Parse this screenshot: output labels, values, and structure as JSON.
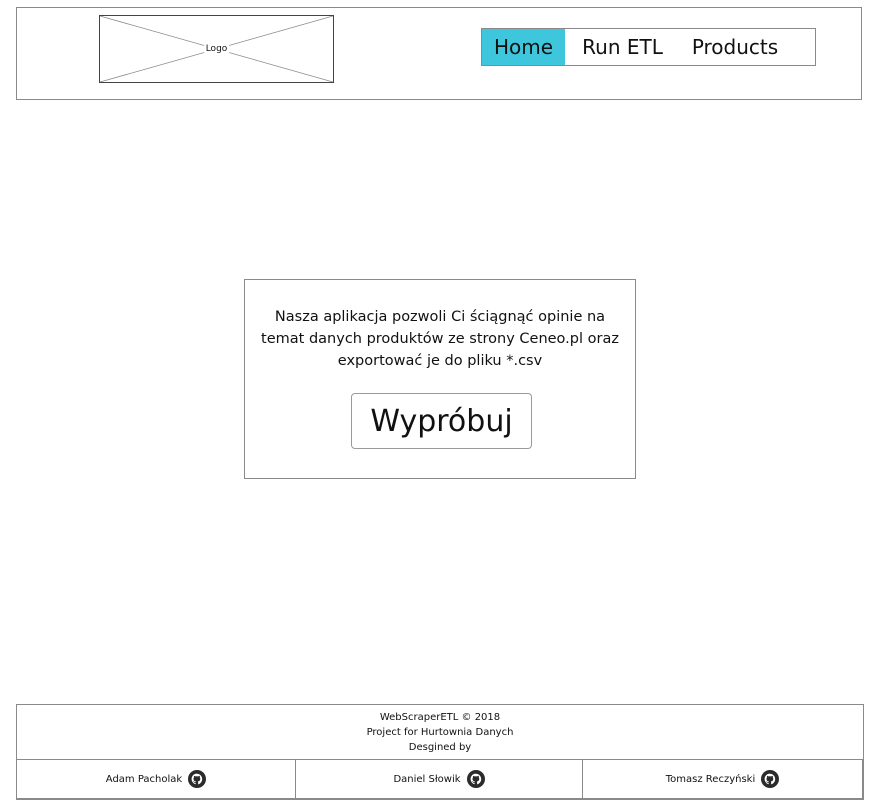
{
  "header": {
    "logo_label": "Logo",
    "nav": [
      {
        "label": "Home",
        "active": true
      },
      {
        "label": "Run ETL",
        "active": false
      },
      {
        "label": "Products",
        "active": false
      }
    ],
    "active_color": "#3ec6dc"
  },
  "main": {
    "description": "Nasza aplikacja pozwoli Ci ściągnąć opinie na temat danych produktów ze strony Ceneo.pl oraz exportować je do pliku *.csv",
    "try_button_label": "Wypróbuj"
  },
  "footer": {
    "copyright": "WebScraperETL © 2018",
    "project": "Project for Hurtownia Danych",
    "designed_by": "Desgined by",
    "authors": [
      {
        "name": "Adam Pacholak",
        "icon": "github-icon"
      },
      {
        "name": "Daniel Słowik",
        "icon": "github-icon"
      },
      {
        "name": "Tomasz Reczyński",
        "icon": "github-icon"
      }
    ]
  }
}
